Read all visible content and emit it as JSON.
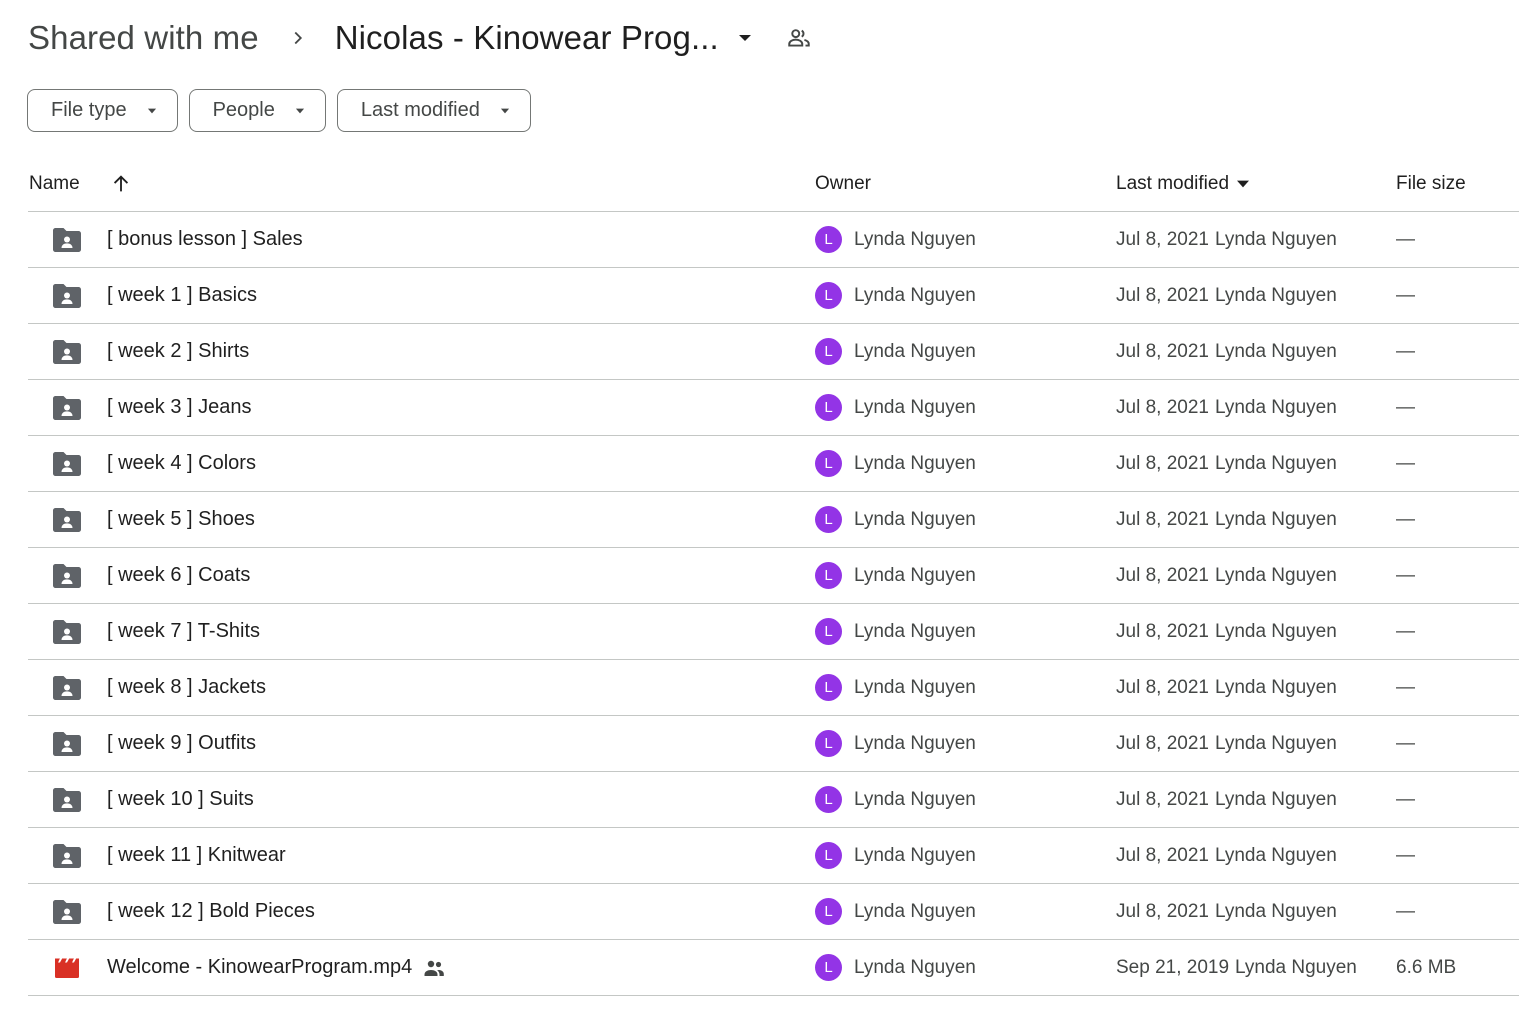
{
  "breadcrumb": {
    "root": "Shared with me",
    "current": "Nicolas - Kinowear Prog...",
    "separator_icon": "chevron-right-icon",
    "caret_icon": "arrow-drop-down-icon",
    "shared_icon": "people-outline-icon"
  },
  "filters": [
    {
      "label": "File type",
      "icon": "arrow-drop-down-icon"
    },
    {
      "label": "People",
      "icon": "arrow-drop-down-icon"
    },
    {
      "label": "Last modified",
      "icon": "arrow-drop-down-icon"
    }
  ],
  "table": {
    "columns": {
      "name": "Name",
      "owner": "Owner",
      "modified": "Last modified",
      "size": "File size"
    },
    "sort_icon": "arrow-upward-icon",
    "rows": [
      {
        "type": "shared-folder",
        "name": "[ bonus lesson ] Sales",
        "owner_initial": "L",
        "owner": "Lynda Nguyen",
        "modified_date": "Jul 8, 2021",
        "modified_by": "Lynda Nguyen",
        "size": "—",
        "shared": false
      },
      {
        "type": "shared-folder",
        "name": "[ week 1 ] Basics",
        "owner_initial": "L",
        "owner": "Lynda Nguyen",
        "modified_date": "Jul 8, 2021",
        "modified_by": "Lynda Nguyen",
        "size": "—",
        "shared": false
      },
      {
        "type": "shared-folder",
        "name": "[ week 2 ] Shirts",
        "owner_initial": "L",
        "owner": "Lynda Nguyen",
        "modified_date": "Jul 8, 2021",
        "modified_by": "Lynda Nguyen",
        "size": "—",
        "shared": false
      },
      {
        "type": "shared-folder",
        "name": "[ week 3 ] Jeans",
        "owner_initial": "L",
        "owner": "Lynda Nguyen",
        "modified_date": "Jul 8, 2021",
        "modified_by": "Lynda Nguyen",
        "size": "—",
        "shared": false
      },
      {
        "type": "shared-folder",
        "name": "[ week 4 ] Colors",
        "owner_initial": "L",
        "owner": "Lynda Nguyen",
        "modified_date": "Jul 8, 2021",
        "modified_by": "Lynda Nguyen",
        "size": "—",
        "shared": false
      },
      {
        "type": "shared-folder",
        "name": "[ week 5 ] Shoes",
        "owner_initial": "L",
        "owner": "Lynda Nguyen",
        "modified_date": "Jul 8, 2021",
        "modified_by": "Lynda Nguyen",
        "size": "—",
        "shared": false
      },
      {
        "type": "shared-folder",
        "name": "[ week 6 ] Coats",
        "owner_initial": "L",
        "owner": "Lynda Nguyen",
        "modified_date": "Jul 8, 2021",
        "modified_by": "Lynda Nguyen",
        "size": "—",
        "shared": false
      },
      {
        "type": "shared-folder",
        "name": "[ week 7 ] T-Shits",
        "owner_initial": "L",
        "owner": "Lynda Nguyen",
        "modified_date": "Jul 8, 2021",
        "modified_by": "Lynda Nguyen",
        "size": "—",
        "shared": false
      },
      {
        "type": "shared-folder",
        "name": "[ week 8 ] Jackets",
        "owner_initial": "L",
        "owner": "Lynda Nguyen",
        "modified_date": "Jul 8, 2021",
        "modified_by": "Lynda Nguyen",
        "size": "—",
        "shared": false
      },
      {
        "type": "shared-folder",
        "name": "[ week 9 ] Outfits",
        "owner_initial": "L",
        "owner": "Lynda Nguyen",
        "modified_date": "Jul 8, 2021",
        "modified_by": "Lynda Nguyen",
        "size": "—",
        "shared": false
      },
      {
        "type": "shared-folder",
        "name": "[ week 10 ] Suits",
        "owner_initial": "L",
        "owner": "Lynda Nguyen",
        "modified_date": "Jul 8, 2021",
        "modified_by": "Lynda Nguyen",
        "size": "—",
        "shared": false
      },
      {
        "type": "shared-folder",
        "name": "[ week 11 ] Knitwear",
        "owner_initial": "L",
        "owner": "Lynda Nguyen",
        "modified_date": "Jul 8, 2021",
        "modified_by": "Lynda Nguyen",
        "size": "—",
        "shared": false
      },
      {
        "type": "shared-folder",
        "name": "[ week 12 ] Bold Pieces",
        "owner_initial": "L",
        "owner": "Lynda Nguyen",
        "modified_date": "Jul 8, 2021",
        "modified_by": "Lynda Nguyen",
        "size": "—",
        "shared": false
      },
      {
        "type": "video",
        "name": "Welcome - KinowearProgram.mp4",
        "owner_initial": "L",
        "owner": "Lynda Nguyen",
        "modified_date": "Sep 21, 2019",
        "modified_by": "Lynda Nguyen",
        "size": "6.6 MB",
        "shared": true
      }
    ]
  },
  "colors": {
    "avatar": "#9334e6",
    "folder_icon": "#5f6368",
    "video_icon": "#d93025",
    "divider": "#c4c7c5",
    "chip_border": "#747775"
  }
}
